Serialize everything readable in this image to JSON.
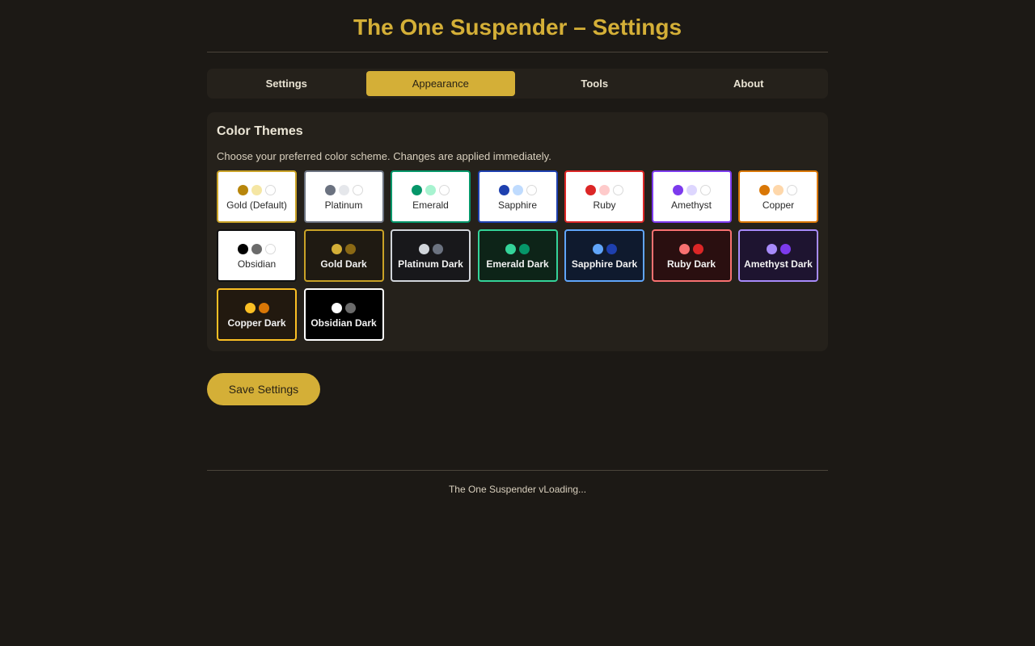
{
  "header": {
    "title": "The One Suspender – Settings"
  },
  "tabs": [
    {
      "label": "Settings",
      "active": false
    },
    {
      "label": "Appearance",
      "active": true
    },
    {
      "label": "Tools",
      "active": false
    },
    {
      "label": "About",
      "active": false
    }
  ],
  "themes_panel": {
    "title": "Color Themes",
    "description": "Choose your preferred color scheme. Changes are applied immediately."
  },
  "themes": [
    {
      "label": "Gold (Default)",
      "mode": "light",
      "bg": "#ffffff",
      "border": "#c9a227",
      "swatches": [
        "#b8860b",
        "#f5e6a3",
        "#ffffff"
      ]
    },
    {
      "label": "Platinum",
      "mode": "light",
      "bg": "#ffffff",
      "border": "#6b7280",
      "swatches": [
        "#6b7280",
        "#e5e7eb",
        "#ffffff"
      ]
    },
    {
      "label": "Emerald",
      "mode": "light",
      "bg": "#ffffff",
      "border": "#059669",
      "swatches": [
        "#059669",
        "#a7f3d0",
        "#ffffff"
      ]
    },
    {
      "label": "Sapphire",
      "mode": "light",
      "bg": "#ffffff",
      "border": "#1e40af",
      "swatches": [
        "#1e40af",
        "#bfdbfe",
        "#ffffff"
      ]
    },
    {
      "label": "Ruby",
      "mode": "light",
      "bg": "#ffffff",
      "border": "#dc2626",
      "swatches": [
        "#dc2626",
        "#fecaca",
        "#ffffff"
      ]
    },
    {
      "label": "Amethyst",
      "mode": "light",
      "bg": "#ffffff",
      "border": "#7c3aed",
      "swatches": [
        "#7c3aed",
        "#ddd6fe",
        "#ffffff"
      ]
    },
    {
      "label": "Copper",
      "mode": "light",
      "bg": "#ffffff",
      "border": "#d97706",
      "swatches": [
        "#d97706",
        "#fed7aa",
        "#ffffff"
      ]
    },
    {
      "label": "Obsidian",
      "mode": "light",
      "bg": "#ffffff",
      "border": "#111111",
      "swatches": [
        "#000000",
        "#6b6b6b",
        "#ffffff"
      ]
    },
    {
      "label": "Gold Dark",
      "mode": "dark",
      "bg": "#1f1a12",
      "border": "#c9a227",
      "swatches": [
        "#d4af37",
        "#8b6914"
      ]
    },
    {
      "label": "Platinum Dark",
      "mode": "dark",
      "bg": "#18181b",
      "border": "#d1d5db",
      "swatches": [
        "#d1d5db",
        "#6b7280"
      ]
    },
    {
      "label": "Emerald Dark",
      "mode": "dark",
      "bg": "#0d2418",
      "border": "#34d399",
      "swatches": [
        "#34d399",
        "#059669"
      ]
    },
    {
      "label": "Sapphire Dark",
      "mode": "dark",
      "bg": "#0f1a2e",
      "border": "#60a5fa",
      "swatches": [
        "#60a5fa",
        "#1e40af"
      ]
    },
    {
      "label": "Ruby Dark",
      "mode": "dark",
      "bg": "#2a0f10",
      "border": "#f87171",
      "swatches": [
        "#f87171",
        "#dc2626"
      ]
    },
    {
      "label": "Amethyst Dark",
      "mode": "dark",
      "bg": "#1e1430",
      "border": "#a78bfa",
      "swatches": [
        "#a78bfa",
        "#7c3aed"
      ]
    },
    {
      "label": "Copper Dark",
      "mode": "dark",
      "bg": "#22190f",
      "border": "#fbbf24",
      "swatches": [
        "#fbbf24",
        "#d97706"
      ]
    },
    {
      "label": "Obsidian Dark",
      "mode": "dark",
      "bg": "#000000",
      "border": "#ffffff",
      "swatches": [
        "#ffffff",
        "#6b6b6b"
      ]
    }
  ],
  "actions": {
    "save_label": "Save Settings"
  },
  "footer": {
    "version_text": "The One Suspender vLoading..."
  },
  "colors": {
    "accent": "#d4af37",
    "background": "#1c1915",
    "panel": "#25211b"
  }
}
